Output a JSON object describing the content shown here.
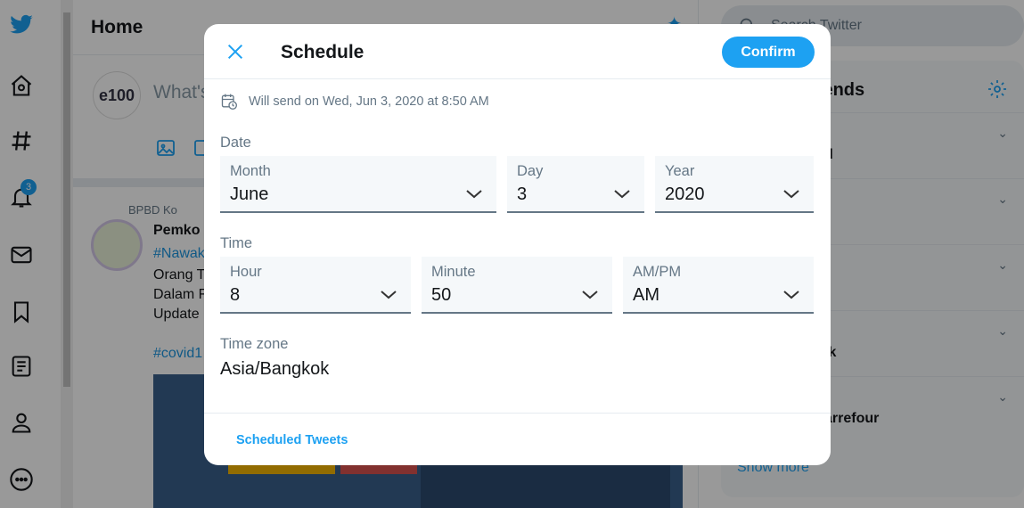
{
  "background": {
    "home_title": "Home",
    "compose_prompt": "What's happening?",
    "compose_avatar": "e100",
    "notification_count": "3",
    "tweet": {
      "social_context": "BPBD Ko",
      "author": "Pemko",
      "lines": [
        "#Nawak",
        "Orang T",
        "Dalam F",
        "Update",
        "#covid1"
      ]
    },
    "search_placeholder": "Search Twitter",
    "trends_title": "trends",
    "trend_labels": [
      "d",
      "",
      "",
      "ik",
      "arrefour"
    ],
    "show_more": "Show more"
  },
  "modal": {
    "title": "Schedule",
    "confirm_label": "Confirm",
    "summary": "Will send on Wed, Jun 3, 2020 at 8:50 AM",
    "date_section": "Date",
    "month": {
      "label": "Month",
      "value": "June"
    },
    "day": {
      "label": "Day",
      "value": "3"
    },
    "year": {
      "label": "Year",
      "value": "2020"
    },
    "time_section": "Time",
    "hour": {
      "label": "Hour",
      "value": "8"
    },
    "minute": {
      "label": "Minute",
      "value": "50"
    },
    "ampm": {
      "label": "AM/PM",
      "value": "AM"
    },
    "timezone_label": "Time zone",
    "timezone_value": "Asia/Bangkok",
    "footer_link": "Scheduled Tweets"
  },
  "colors": {
    "accent": "#1da1f2",
    "muted": "#657786",
    "field_bg": "#f5f8fa"
  }
}
